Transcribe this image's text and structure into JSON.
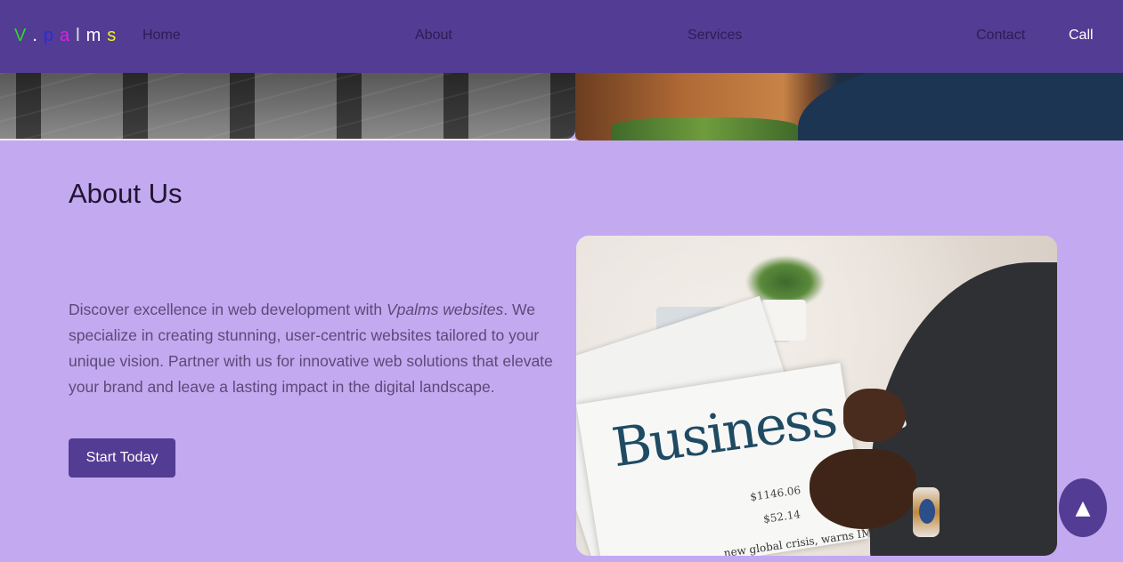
{
  "nav": {
    "logo_letters": [
      {
        "char": "V",
        "color": "#2ed62e"
      },
      {
        "char": ".",
        "color": "#ffffff"
      },
      {
        "char": "p",
        "color": "#2a2ae0"
      },
      {
        "char": "a",
        "color": "#e020e0"
      },
      {
        "char": "l",
        "color": "#e0e0e0"
      },
      {
        "char": "m",
        "color": "#ffffff"
      },
      {
        "char": "s",
        "color": "#f0f020"
      }
    ],
    "links": {
      "home": "Home",
      "about": "About",
      "services": "Services",
      "contact": "Contact",
      "call": "Call"
    }
  },
  "about": {
    "title": "About Us",
    "text_before": "Discover excellence in web development with ",
    "text_emphasis": "Vpalms websites",
    "text_after": ". We specialize in creating stunning, user-centric websites tailored to your unique vision. Partner with us for innovative web solutions that elevate your brand and leave a lasting impact in the digital landscape.",
    "cta_label": "Start Today",
    "image": {
      "headline": "Business",
      "price_1": "$1146.06",
      "price_2": "$52.14",
      "sub_headline": "new global crisis, warns IMF"
    }
  },
  "scroll_top": {
    "icon": "arrow-up-icon",
    "glyph": "▲"
  },
  "colors": {
    "nav_bg": "#533c93",
    "page_bg": "#c3a9f0",
    "button_bg": "#533c93"
  }
}
